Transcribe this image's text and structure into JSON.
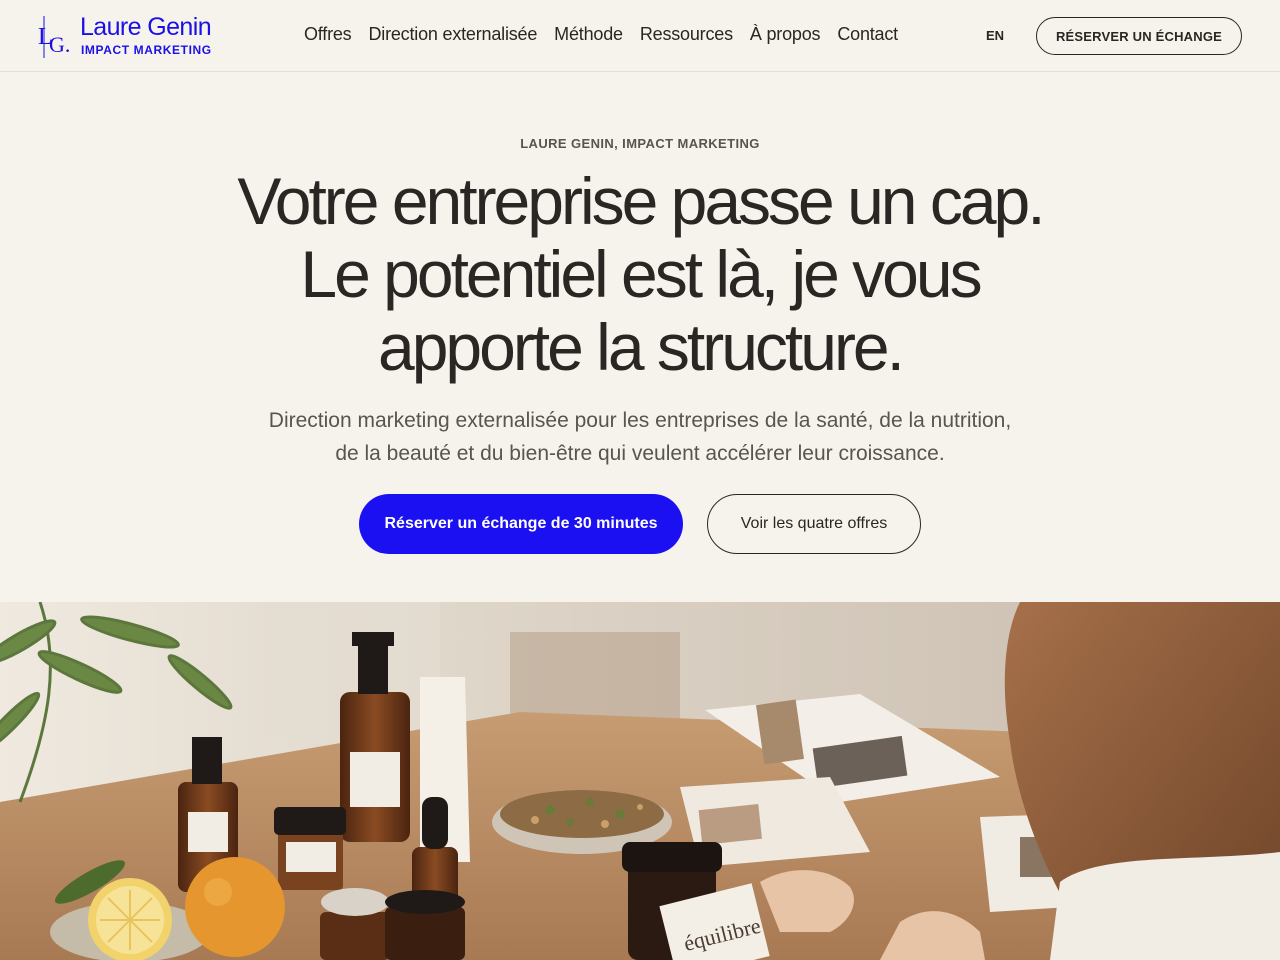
{
  "header": {
    "logo_name": "Laure Genin",
    "logo_sub": "IMPACT MARKETING",
    "nav": [
      "Offres",
      "Direction externalisée",
      "Méthode",
      "Ressources",
      "À propos",
      "Contact"
    ],
    "lang": "EN",
    "cta": "RÉSERVER UN ÉCHANGE"
  },
  "hero": {
    "eyebrow": "LAURE GENIN, IMPACT MARKETING",
    "title_lines": [
      "Votre entreprise passe un cap.",
      "Le potentiel est là, je vous",
      "apporte la structure."
    ],
    "subtitle_lines": [
      "Direction marketing externalisée pour les entreprises de la santé, de la nutrition,",
      "de la beauté et du bien-être qui veulent accélérer leur croissance."
    ],
    "primary_cta": "Réserver un échange de 30 minutes",
    "secondary_cta": "Voir les quatre offres",
    "card_text": "équilibre"
  },
  "colors": {
    "brand": "#1b10f2",
    "background": "#f6f3ec",
    "text": "#2a2623"
  }
}
